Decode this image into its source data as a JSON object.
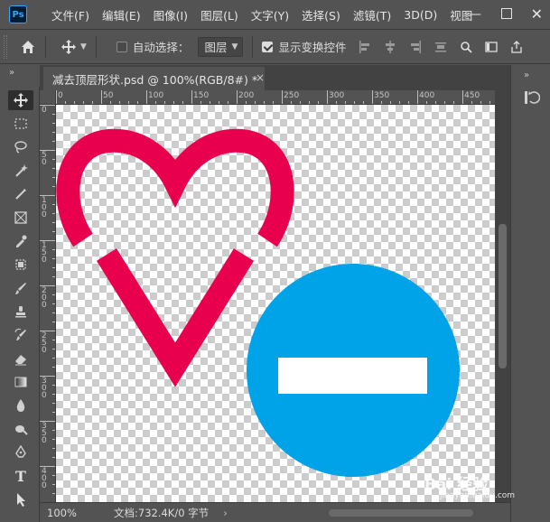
{
  "app": {
    "logo": "Ps"
  },
  "menu": [
    "文件(F)",
    "编辑(E)",
    "图像(I)",
    "图层(L)",
    "文字(Y)",
    "选择(S)",
    "滤镜(T)",
    "3D(D)",
    "视图"
  ],
  "window_controls": {
    "minimize": "—",
    "close": "✕"
  },
  "options": {
    "auto_select_label": "自动选择：",
    "auto_select_checked": false,
    "layer_select_value": "图层",
    "show_transform_label": "显示变换控件",
    "show_transform_checked": true
  },
  "panel_collapse": "»",
  "document_tab": {
    "title": "减去顶层形状.psd @ 100%(RGB/8#) *",
    "close": "×"
  },
  "ruler_h_labels": [
    "0",
    "50",
    "100",
    "150",
    "200",
    "250",
    "300",
    "350",
    "400",
    "450"
  ],
  "ruler_v_labels": [
    "0",
    "5 0",
    "1 0 0",
    "1 5 0",
    "2 0 0",
    "2 5 0",
    "3 0 0",
    "3 5 0",
    "4 0 0"
  ],
  "status": {
    "zoom": "100%",
    "doc_info": "文档:732.4K/0 字节",
    "arrow": "›"
  },
  "colors": {
    "heart": "#e8004f",
    "circle": "#00a2e8",
    "minus_bar": "#ffffff"
  },
  "watermark": {
    "main": "Bai 经验",
    "sub": "jingyan.baidu.com"
  }
}
